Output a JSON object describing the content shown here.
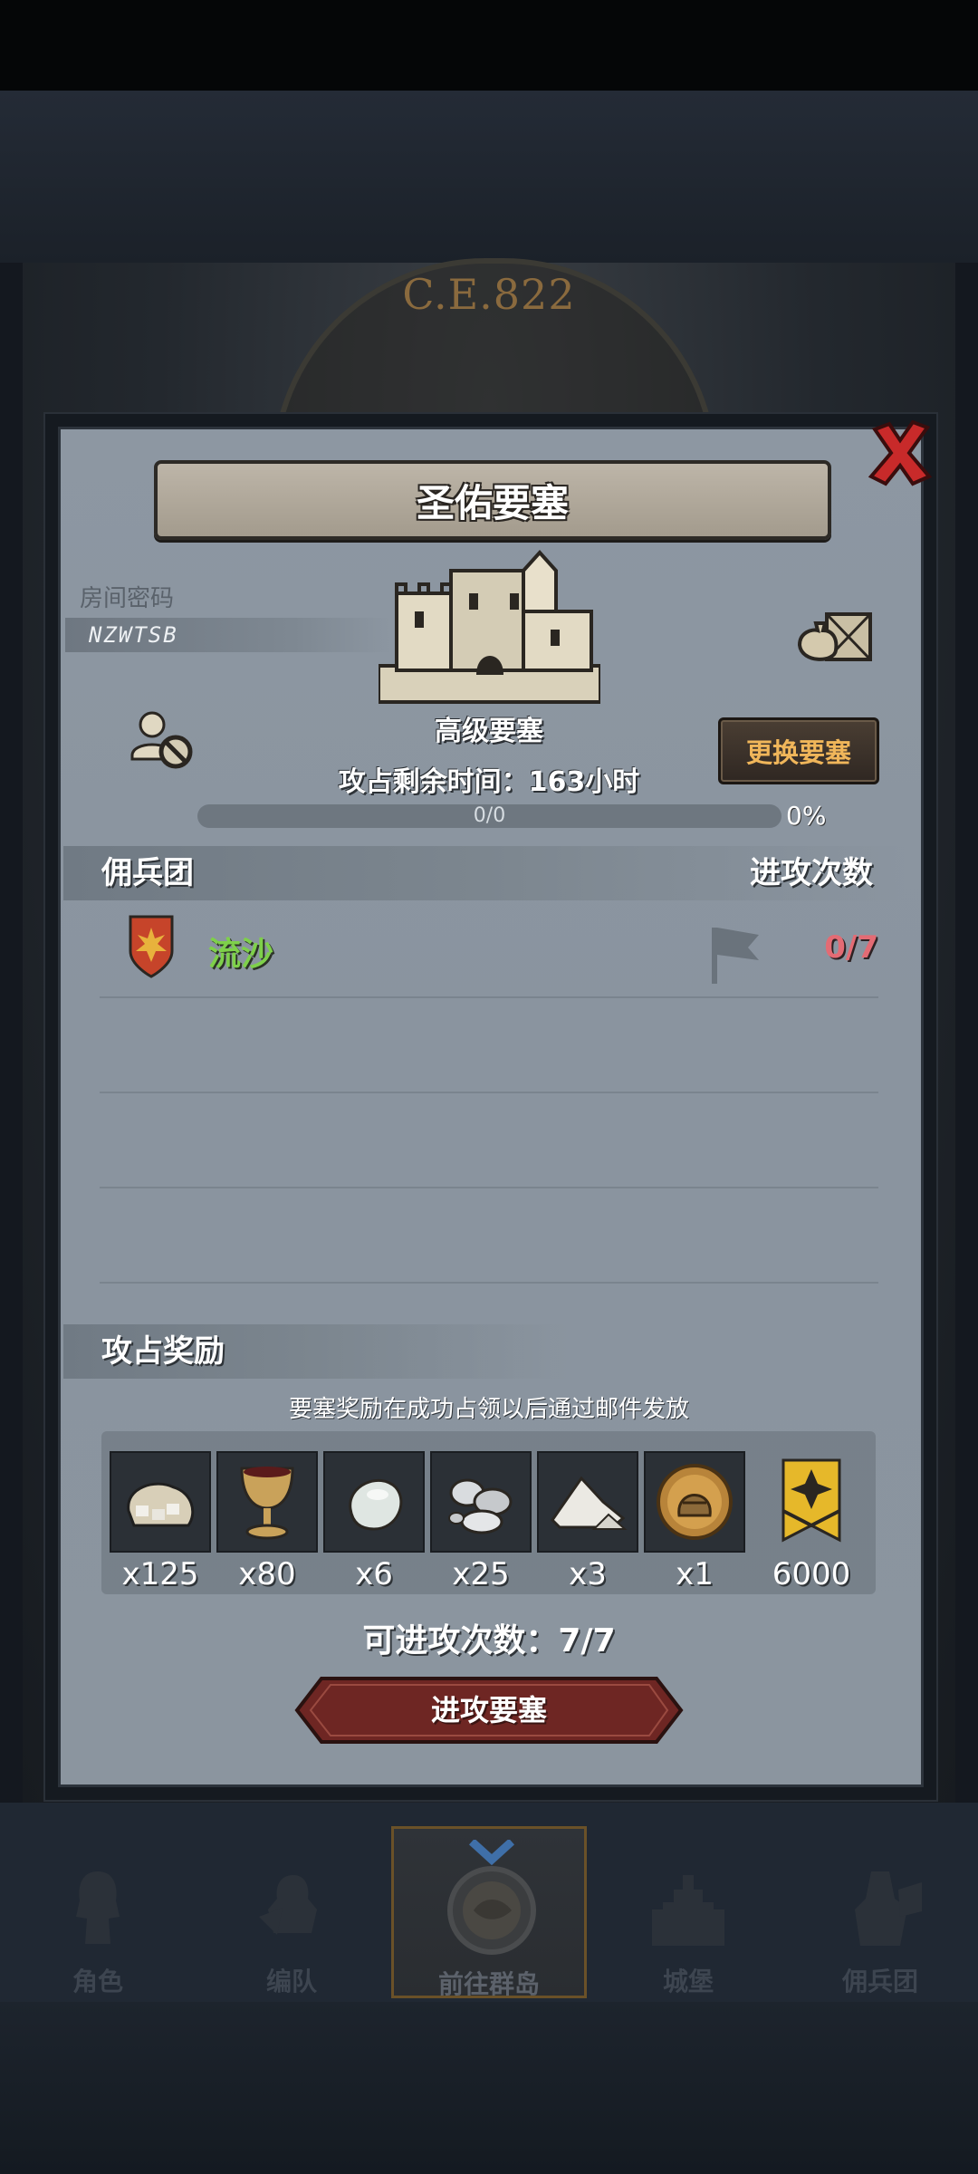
{
  "background": {
    "era_label": "C.E.822"
  },
  "dialog": {
    "title": "圣佑要塞",
    "room_code_label": "房间密码",
    "room_code": "NZWTSB",
    "fortress_type": "高级要塞",
    "change_button": "更换要塞",
    "timer_text": "攻占剩余时间：163小时",
    "progress": {
      "text": "0/0",
      "percent_label": "0%",
      "fraction": 0.0
    },
    "mercenary_section": {
      "left": "佣兵团",
      "right": "进攻次数"
    },
    "mercenaries": [
      {
        "name": "流沙",
        "attacks": "0/7"
      }
    ],
    "reward_section": {
      "title": "攻占奖励"
    },
    "reward_note": "要塞奖励在成功占领以后通过邮件发放",
    "rewards": [
      {
        "icon": "ore-sack-icon",
        "qty": "x125"
      },
      {
        "icon": "goblet-icon",
        "qty": "x80"
      },
      {
        "icon": "pearl-stone-icon",
        "qty": "x6"
      },
      {
        "icon": "silver-ore-icon",
        "qty": "x25"
      },
      {
        "icon": "salt-pile-icon",
        "qty": "x3"
      },
      {
        "icon": "knight-helmet-coin-icon",
        "qty": "x1"
      },
      {
        "icon": "honor-banner-icon",
        "qty": "6000"
      }
    ],
    "attack_count_text": "可进攻次数：7/7",
    "attack_button": "进攻要塞"
  },
  "nav": {
    "items": [
      {
        "label": "角色",
        "icon": "character-icon"
      },
      {
        "label": "编队",
        "icon": "formation-icon"
      },
      {
        "label": "前往群岛",
        "icon": "islands-icon",
        "active": true
      },
      {
        "label": "城堡",
        "icon": "castle-icon"
      },
      {
        "label": "佣兵团",
        "icon": "mercenary-icon"
      }
    ]
  },
  "colors": {
    "panel": "#8b959f",
    "accent_gold": "#f0b65a",
    "mercenary_name": "#7ed04a",
    "attack_count_red": "#e36b74",
    "attack_button": "#6e2623"
  }
}
